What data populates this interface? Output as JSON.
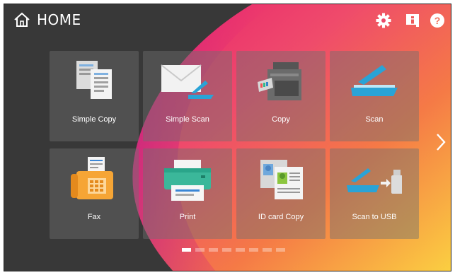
{
  "header": {
    "home_label": "HOME"
  },
  "tiles": [
    {
      "label": "Simple Copy"
    },
    {
      "label": "Simple Scan"
    },
    {
      "label": "Copy"
    },
    {
      "label": "Scan"
    },
    {
      "label": "Fax"
    },
    {
      "label": "Print"
    },
    {
      "label": "ID card Copy"
    },
    {
      "label": "Scan to USB"
    }
  ],
  "icons": {
    "home": "home-icon",
    "settings": "gear-icon",
    "info": "info-icon",
    "help": "help-icon",
    "next": "chevron-right-icon"
  },
  "pagination": {
    "total_pages": 8,
    "current_page": 1
  },
  "colors": {
    "dark_background": "#383838",
    "gradient_pink": "#e8206f",
    "gradient_orange": "#f79a2a",
    "gradient_yellow": "#fbd041",
    "accent_teal": "#2aa3d6"
  }
}
